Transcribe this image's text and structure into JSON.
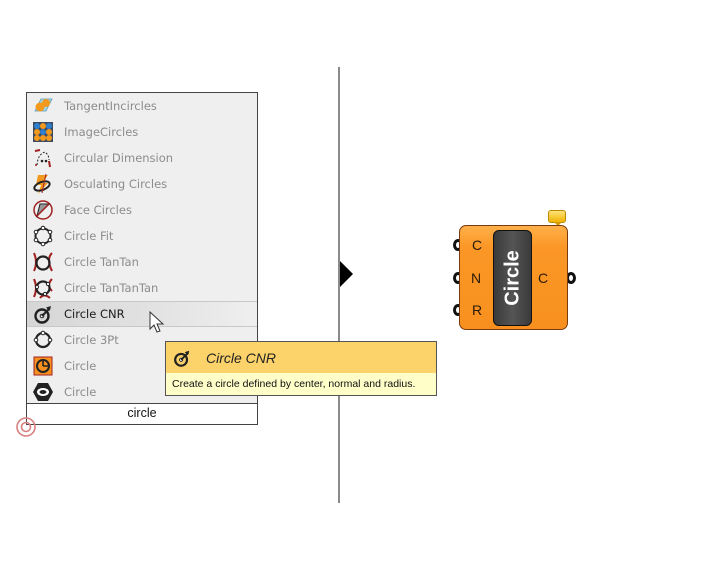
{
  "search_panel": {
    "items": [
      {
        "label": "TangentIncircles",
        "icon": "tangent-incircles-icon",
        "active": false
      },
      {
        "label": "ImageCircles",
        "icon": "image-circles-icon",
        "active": false
      },
      {
        "label": "Circular Dimension",
        "icon": "circular-dimension-icon",
        "active": false
      },
      {
        "label": "Osculating Circles",
        "icon": "osculating-circles-icon",
        "active": false
      },
      {
        "label": "Face Circles",
        "icon": "face-circles-icon",
        "active": false
      },
      {
        "label": "Circle Fit",
        "icon": "circle-fit-icon",
        "active": false
      },
      {
        "label": "Circle TanTan",
        "icon": "circle-tantan-icon",
        "active": false
      },
      {
        "label": "Circle TanTanTan",
        "icon": "circle-tantantan-icon",
        "active": false
      },
      {
        "label": "Circle CNR",
        "icon": "circle-cnr-icon",
        "active": true
      },
      {
        "label": "Circle 3Pt",
        "icon": "circle-3pt-icon",
        "active": false
      },
      {
        "label": "Circle",
        "icon": "circle-param-icon",
        "active": false
      },
      {
        "label": "Circle",
        "icon": "circle-hex-icon",
        "active": false
      }
    ],
    "search_value": "circle"
  },
  "tooltip": {
    "title": "Circle CNR",
    "description": "Create a circle defined by center, normal and radius."
  },
  "component": {
    "name": "Circle",
    "inputs": [
      "C",
      "N",
      "R"
    ],
    "outputs": [
      "C"
    ],
    "colors": {
      "body": "#f7901e",
      "pill": "#444444",
      "balloon": "#f5c83a"
    }
  }
}
